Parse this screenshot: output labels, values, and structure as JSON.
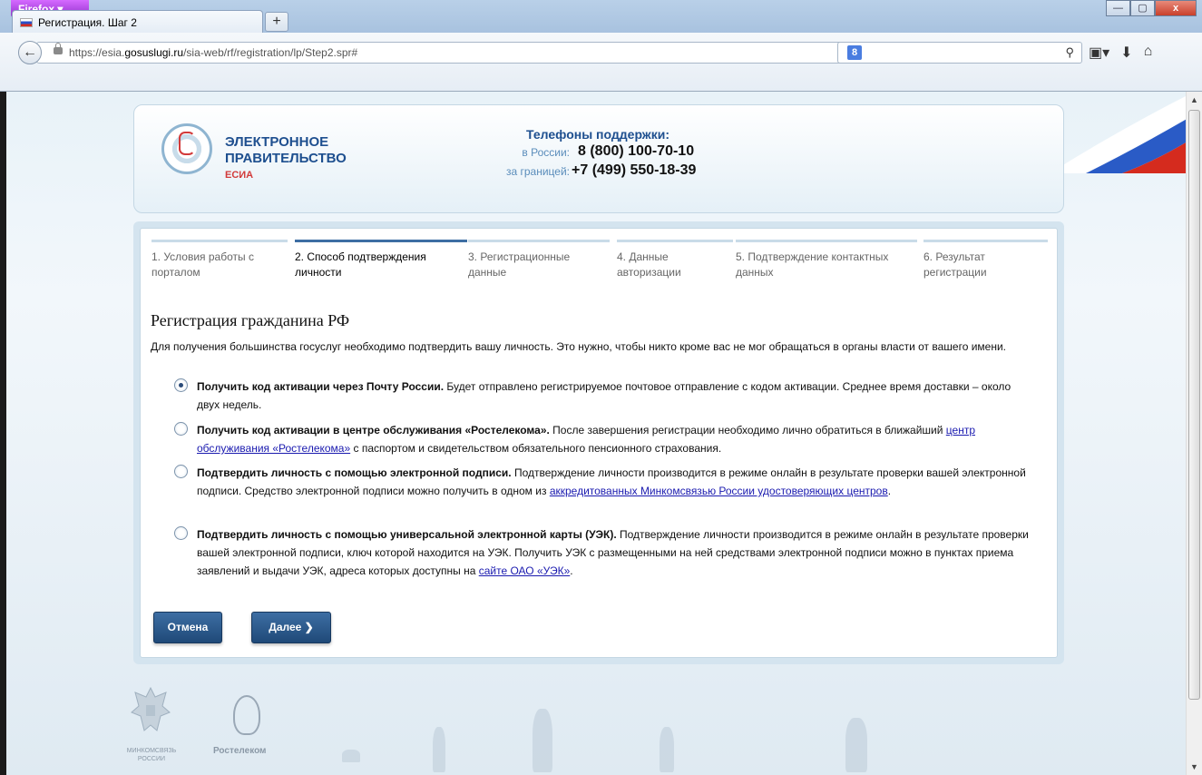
{
  "browser": {
    "app_menu": "Firefox",
    "tab_title": "Регистрация. Шаг 2",
    "new_tab": "+",
    "url_prefix": "https://esia.",
    "url_domain": "gosuslugi.ru",
    "url_path": "/sia-web/rf/registration/lp/Step2.spr#",
    "search_engine": "8",
    "window_controls": {
      "minimize": "—",
      "maximize": "▢",
      "close": "x"
    }
  },
  "header": {
    "logo_line1": "ЭЛЕКТРОННОЕ",
    "logo_line2": "ПРАВИТЕЛЬСТВО",
    "logo_line3": "ЕСИА",
    "phones_title": "Телефоны поддержки:",
    "russia_label": "в России:",
    "russia_number": "8 (800) 100-70-10",
    "abroad_label": "за границей:",
    "abroad_number": "+7 (499) 550-18-39"
  },
  "steps": [
    {
      "label": "1. Условия работы с порталом",
      "active": false
    },
    {
      "label": "2. Способ подтверждения личности",
      "active": true
    },
    {
      "label": "3. Регистрационные данные",
      "active": false
    },
    {
      "label": "4. Данные авторизации",
      "active": false
    },
    {
      "label": "5. Подтверждение контактных данных",
      "active": false
    },
    {
      "label": "6. Результат регистрации",
      "active": false
    }
  ],
  "main": {
    "title": "Регистрация гражданина РФ",
    "intro": "Для получения большинства госуслуг необходимо подтвердить вашу личность. Это нужно, чтобы никто кроме вас не мог обращаться в органы власти от вашего имени.",
    "options": [
      {
        "bold": "Получить код активации через Почту России.",
        "text": " Будет отправлено регистрируемое почтовое отправление с кодом активации. Среднее время доставки – около двух недель.",
        "selected": true
      },
      {
        "bold": "Получить код активации в центре обслуживания «Ростелекома».",
        "text": " После завершения регистрации необходимо лично обратиться в ближайший ",
        "link": "центр обслуживания «Ростелекома»",
        "text_after": " с паспортом и свидетельством обязательного пенсионного страхования.",
        "selected": false
      },
      {
        "bold": "Подтвердить личность с помощью электронной подписи.",
        "text": " Подтверждение личности производится в режиме онлайн в результате проверки вашей электронной подписи. Средство электронной подписи можно получить в одном из ",
        "link": "аккредитованных Минкомсвязью России удостоверяющих центров",
        "text_after": ".",
        "selected": false
      },
      {
        "bold": "Подтвердить личность с помощью универсальной электронной карты (УЭК).",
        "text": " Подтверждение личности производится в режиме онлайн в результате проверки вашей электронной подписи, ключ которой находится на УЭК. Получить УЭК с размещенными на ней средствами электронной подписи можно в пунктах приема заявлений и выдачи УЭК, адреса которых доступны на ",
        "link": "сайте ОАО «УЭК»",
        "text_after": ".",
        "selected": false
      }
    ],
    "cancel_label": "Отмена",
    "next_label": "Далее ❯"
  },
  "footer": {
    "ministry_label": "МИНКОМСВЯЗЬ РОССИИ",
    "rostelecom_label": "Ростелеком"
  },
  "colors": {
    "accent": "#1f4978",
    "link": "#1a1aaf",
    "active_step": "#3d6ea3",
    "logo_red": "#d23a3a"
  }
}
